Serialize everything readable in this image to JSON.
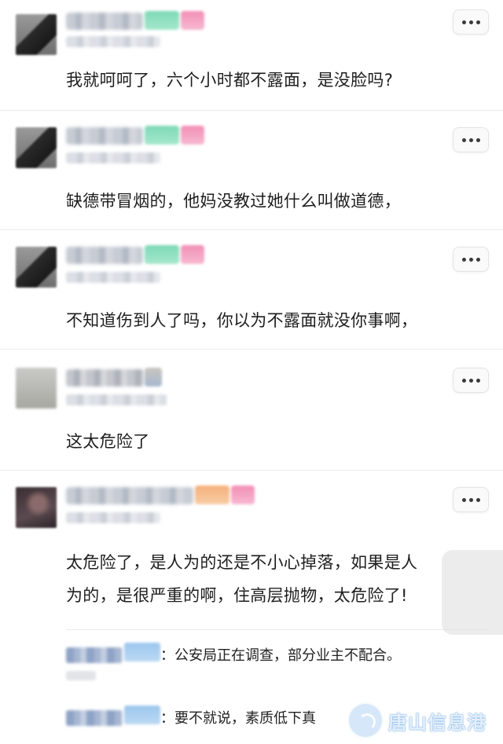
{
  "comments": [
    {
      "text": "我就呵呵了，六个小时都不露面，是没脸吗?"
    },
    {
      "text": "缺德带冒烟的，他妈没教过她什么叫做道德，"
    },
    {
      "text": "不知道伤到人了吗，你以为不露面就没你事啊，"
    },
    {
      "text": "这太危险了"
    },
    {
      "text_line1": "太危险了，是人为的还是不小心掉落，如果是人",
      "text_line2": "为的，是很严重的啊，住高层抛物，太危险了!",
      "replies": [
        {
          "text": "：公安局正在调查，部分业主不配合。"
        },
        {
          "text": "：要不就说，素质低下真"
        }
      ]
    }
  ],
  "watermark": {
    "text": "唐山信息港"
  },
  "icons": {
    "more": "more-dots-icon",
    "logo": "watermark-logo-icon"
  },
  "colors": {
    "badge_green": "#7ed9b6",
    "badge_pink": "#f28fb6",
    "badge_orange": "#f5b07a",
    "badge_blue": "#9cc7ee"
  }
}
